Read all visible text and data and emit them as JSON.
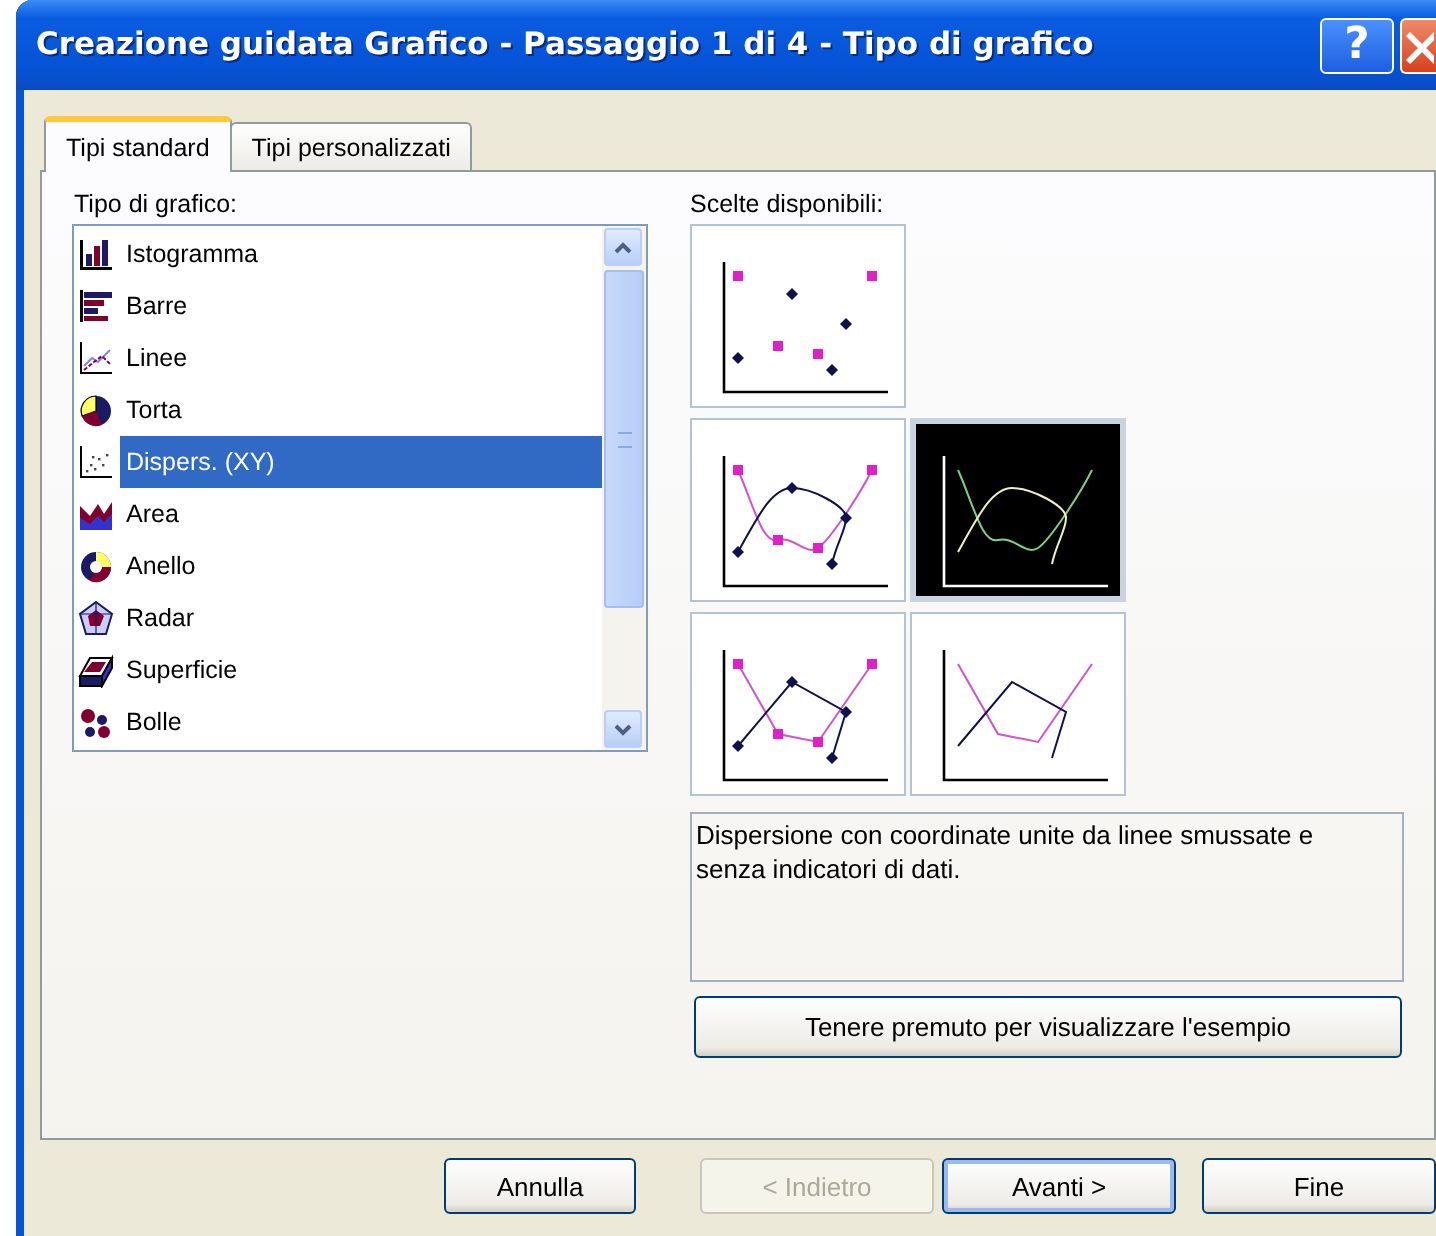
{
  "window": {
    "title": "Creazione guidata Grafico - Passaggio 1 di 4 - Tipo di grafico",
    "help_button": "?"
  },
  "tabs": [
    {
      "label": "Tipi standard",
      "selected": true
    },
    {
      "label": "Tipi personalizzati",
      "selected": false
    }
  ],
  "chart_types": {
    "label": "Tipo di grafico:",
    "items": [
      {
        "label": "Istogramma",
        "kind": "column",
        "selected": false
      },
      {
        "label": "Barre",
        "kind": "bar",
        "selected": false
      },
      {
        "label": "Linee",
        "kind": "line",
        "selected": false
      },
      {
        "label": "Torta",
        "kind": "pie",
        "selected": false
      },
      {
        "label": "Dispers. (XY)",
        "kind": "scatter",
        "selected": true
      },
      {
        "label": "Area",
        "kind": "area",
        "selected": false
      },
      {
        "label": "Anello",
        "kind": "doughnut",
        "selected": false
      },
      {
        "label": "Radar",
        "kind": "radar",
        "selected": false
      },
      {
        "label": "Superficie",
        "kind": "surface",
        "selected": false
      },
      {
        "label": "Bolle",
        "kind": "bubble",
        "selected": false
      }
    ]
  },
  "subtypes": {
    "label": "Scelte disponibili:",
    "options": [
      {
        "kind": "markers",
        "selected": false
      },
      {
        "kind": "smooth_markers",
        "selected": false
      },
      {
        "kind": "smooth",
        "selected": true
      },
      {
        "kind": "lines_markers",
        "selected": false
      },
      {
        "kind": "lines",
        "selected": false
      }
    ]
  },
  "description": "Dispersione con coordinate unite da linee smussate e senza indicatori di dati.",
  "preview_button": "Tenere premuto per visualizzare l'esempio",
  "buttons": [
    {
      "label": "Annulla",
      "disabled": false,
      "default": false
    },
    {
      "label": "< Indietro",
      "disabled": true,
      "default": false
    },
    {
      "label": "Avanti >",
      "disabled": false,
      "default": true
    },
    {
      "label": "Fine",
      "disabled": false,
      "default": false
    }
  ]
}
